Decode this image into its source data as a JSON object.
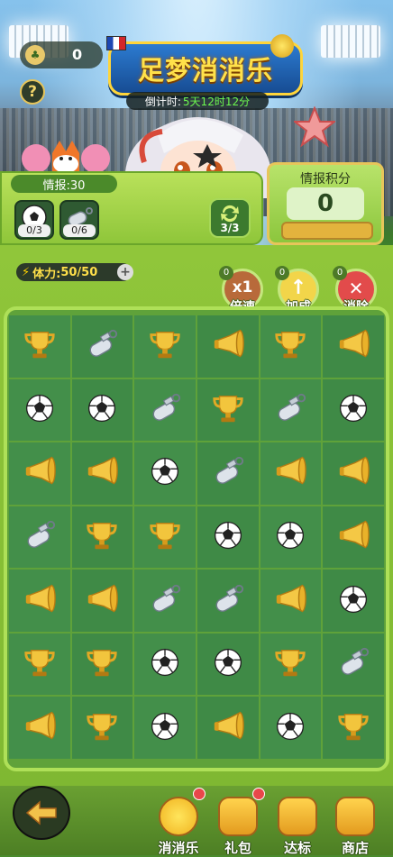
{
  "header": {
    "coin_count": "0",
    "help_label": "?",
    "title": "足梦消消乐",
    "countdown_label": "倒计时:",
    "countdown_value": "5天12时12分"
  },
  "intel": {
    "label": "情报:30",
    "items": [
      {
        "icon": "soccer-ball-icon",
        "count": "0/3"
      },
      {
        "icon": "whistle-icon",
        "count": "0/6"
      }
    ],
    "refresh_count": "3/3"
  },
  "score": {
    "label": "情报积分",
    "value": "0"
  },
  "stamina": {
    "label": "体力:",
    "value": "50/50"
  },
  "tools": [
    {
      "name": "multiplier",
      "label": "倍速",
      "badge": "0",
      "glyph": "x1"
    },
    {
      "name": "boost",
      "label": "加成",
      "badge": "0",
      "glyph": "↑"
    },
    {
      "name": "eliminate",
      "label": "消除",
      "badge": "0",
      "glyph": "✕"
    }
  ],
  "board": [
    [
      "trophy",
      "whistle",
      "trophy",
      "horn",
      "trophy",
      "horn"
    ],
    [
      "ball",
      "ball",
      "whistle",
      "trophy",
      "whistle",
      "ball"
    ],
    [
      "horn",
      "horn",
      "ball",
      "whistle",
      "horn",
      "horn"
    ],
    [
      "whistle",
      "trophy",
      "trophy",
      "ball",
      "ball",
      "horn"
    ],
    [
      "horn",
      "horn",
      "whistle",
      "whistle",
      "horn",
      "ball"
    ],
    [
      "trophy",
      "trophy",
      "ball",
      "ball",
      "trophy",
      "whistle"
    ],
    [
      "horn",
      "trophy",
      "ball",
      "horn",
      "ball",
      "trophy"
    ]
  ],
  "nav": [
    {
      "label": "消消乐",
      "icon": "soccer-ball-icon",
      "dot": true
    },
    {
      "label": "礼包",
      "icon": "gift-icon",
      "dot": true
    },
    {
      "label": "达标",
      "icon": "check-badge-icon",
      "dot": false
    },
    {
      "label": "商店",
      "icon": "shop-icon",
      "dot": false
    }
  ],
  "colors": {
    "title_fill": "#ffe14a",
    "countdown_value": "#6cf74f",
    "stamina_text": "#ffe04a",
    "board_green": "#3f8a46"
  }
}
